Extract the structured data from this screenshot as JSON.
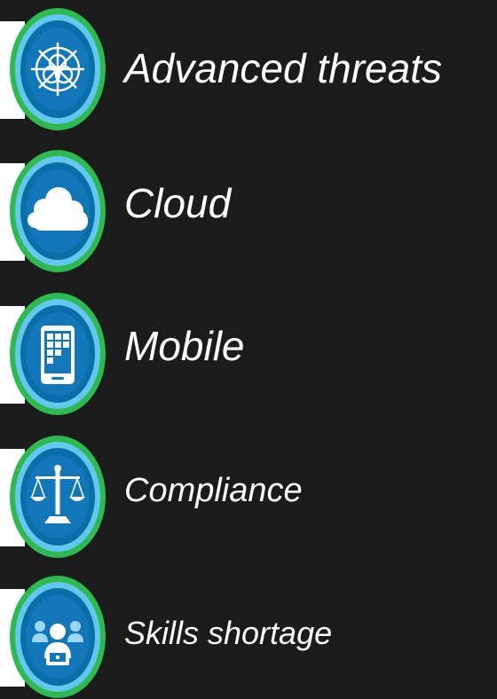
{
  "items": [
    {
      "label": "Advanced threats",
      "icon": "biohazard-icon"
    },
    {
      "label": "Cloud",
      "icon": "cloud-icon"
    },
    {
      "label": "Mobile",
      "icon": "mobile-device-icon"
    },
    {
      "label": "Compliance",
      "icon": "scales-of-justice-icon"
    },
    {
      "label": "Skills shortage",
      "icon": "people-at-computers-icon"
    }
  ],
  "colors": {
    "background": "#1b1b1b",
    "ring_green": "#2dba4e",
    "ring_light_blue": "#63c7f0",
    "ring_dark_blue": "#0a6fa8",
    "icon_face": "#1277b8",
    "text": "#ffffff"
  }
}
